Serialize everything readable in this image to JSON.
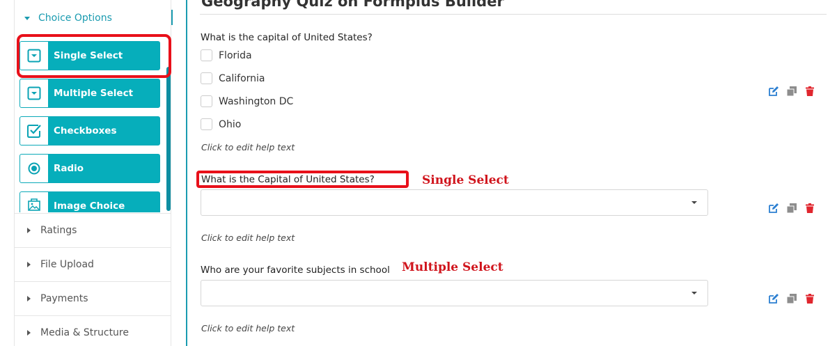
{
  "sidebar": {
    "group_header": "Choice Options",
    "items": [
      {
        "label": "Single Select",
        "icon": "dropdown-icon"
      },
      {
        "label": "Multiple Select",
        "icon": "dropdown-icon"
      },
      {
        "label": "Checkboxes",
        "icon": "checkbox-icon"
      },
      {
        "label": "Radio",
        "icon": "radio-icon"
      },
      {
        "label": "Image Choice",
        "icon": "image-icon"
      }
    ],
    "sections": [
      {
        "label": "Ratings"
      },
      {
        "label": "File Upload"
      },
      {
        "label": "Payments"
      },
      {
        "label": "Media & Structure"
      }
    ]
  },
  "form": {
    "title": "Geography Quiz on Formplus Builder",
    "questions": [
      {
        "label": "What is the capital of United States?",
        "options": [
          "Florida",
          "California",
          "Washington DC",
          "Ohio"
        ],
        "help": "Click to edit help text"
      },
      {
        "label": "What is the Capital of United States?",
        "annotation": "Single Select",
        "help": "Click to edit help text"
      },
      {
        "label": "Who are your favorite subjects in school",
        "annotation": "Multiple Select",
        "help": "Click to edit help text"
      }
    ]
  },
  "colors": {
    "accent": "#06aebb",
    "annotation_red": "#d0141c",
    "edit_blue": "#2b7fd1",
    "delete_red": "#e0262e"
  }
}
